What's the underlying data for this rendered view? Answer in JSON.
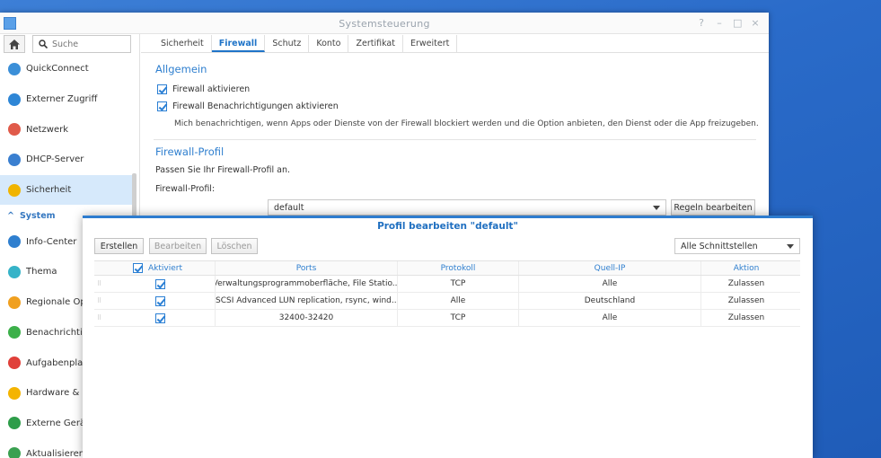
{
  "window": {
    "title": "Systemsteuerung",
    "controls": [
      "?",
      "–",
      "□",
      "×"
    ]
  },
  "sidebar": {
    "search_placeholder": "Suche",
    "items": [
      {
        "label": "QuickConnect",
        "icon": "quickconnect-icon",
        "color": "#3b8fd8"
      },
      {
        "label": "Externer Zugriff",
        "icon": "globe-icon",
        "color": "#2e86d6"
      },
      {
        "label": "Netzwerk",
        "icon": "network-house-icon",
        "color": "#e05a4a"
      },
      {
        "label": "DHCP-Server",
        "icon": "dhcp-icon",
        "color": "#3a7fd0"
      },
      {
        "label": "Sicherheit",
        "icon": "shield-icon",
        "color": "#f0b400",
        "active": true
      }
    ],
    "group_label": "System",
    "system_items": [
      {
        "label": "Info-Center",
        "icon": "info-icon",
        "color": "#2f7fcf"
      },
      {
        "label": "Thema",
        "icon": "palette-icon",
        "color": "#36b3c8"
      },
      {
        "label": "Regionale Op",
        "icon": "regional-options-icon",
        "color": "#f0a020"
      },
      {
        "label": "Benachrichtig",
        "icon": "notification-icon",
        "color": "#3cb04a"
      },
      {
        "label": "Aufgabenplan",
        "icon": "calendar-icon",
        "color": "#e0403a"
      },
      {
        "label": "Hardware & E",
        "icon": "bulb-icon",
        "color": "#f4b400"
      },
      {
        "label": "Externe Gerä",
        "icon": "external-device-icon",
        "color": "#2e9d4a"
      },
      {
        "label": "Aktualisieren",
        "icon": "update-icon",
        "color": "#3aa050"
      }
    ]
  },
  "tabs": [
    "Sicherheit",
    "Firewall",
    "Schutz",
    "Konto",
    "Zertifikat",
    "Erweitert"
  ],
  "active_tab": "Firewall",
  "general": {
    "title": "Allgemein",
    "enable_firewall": "Firewall aktivieren",
    "enable_notifications": "Firewall Benachrichtigungen aktivieren",
    "note": "Mich benachrichtigen, wenn Apps oder Dienste von der Firewall blockiert werden und die Option anbieten, den Dienst oder die App freizugeben."
  },
  "profile": {
    "title": "Firewall-Profil",
    "hint": "Passen Sie Ihr Firewall-Profil an.",
    "label": "Firewall-Profil:",
    "value": "default",
    "edit_rules": "Regeln bearbeiten"
  },
  "dialog": {
    "title": "Profil bearbeiten \"default\"",
    "create": "Erstellen",
    "edit": "Bearbeiten",
    "delete": "Löschen",
    "interface_select": "Alle Schnittstellen",
    "columns": [
      "Aktiviert",
      "Ports",
      "Protokoll",
      "Quell-IP",
      "Aktion"
    ],
    "rows": [
      {
        "ports": "Verwaltungsprogrammoberfläche, File Statio...",
        "protocol": "TCP",
        "source": "Alle",
        "action": "Zulassen"
      },
      {
        "ports": "iSCSI Advanced LUN replication, rsync, wind...",
        "protocol": "Alle",
        "source": "Deutschland",
        "action": "Zulassen"
      },
      {
        "ports": "32400-32420",
        "protocol": "TCP",
        "source": "Alle",
        "action": "Zulassen"
      }
    ]
  }
}
